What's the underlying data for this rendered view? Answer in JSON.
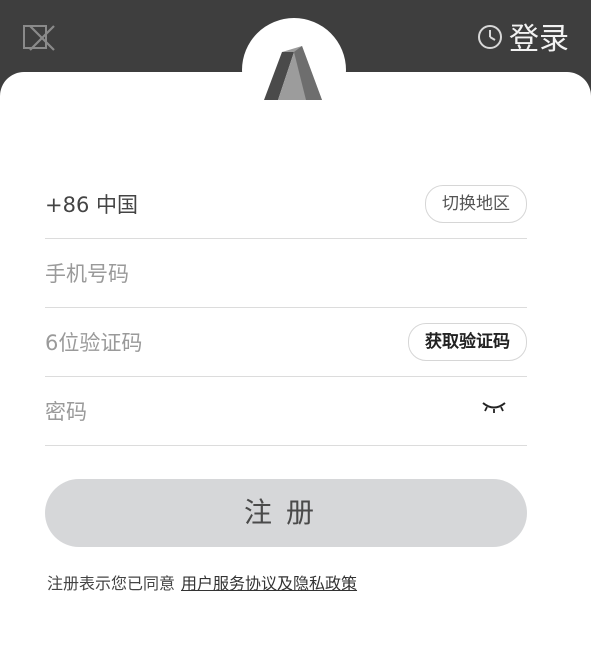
{
  "header": {
    "close_icon": "close-x-icon",
    "login_label": "登录",
    "login_icon": "clock-icon"
  },
  "logo": {
    "icon": "app-logo-icon"
  },
  "form": {
    "region": {
      "value": "+86 中国",
      "switch_label": "切换地区"
    },
    "phone": {
      "placeholder": "手机号码"
    },
    "code": {
      "placeholder": "6位验证码",
      "get_code_label": "获取验证码"
    },
    "password": {
      "placeholder": "密码",
      "toggle_icon": "eye-closed-icon"
    },
    "register_label": "注册"
  },
  "terms": {
    "prefix": "注册表示您已同意",
    "link": "用户服务协议及隐私政策"
  },
  "colors": {
    "top_bar": "#3e3e3e",
    "sheet": "#ffffff",
    "button_bg": "#d6d7d9",
    "divider": "#dcdcdc"
  }
}
